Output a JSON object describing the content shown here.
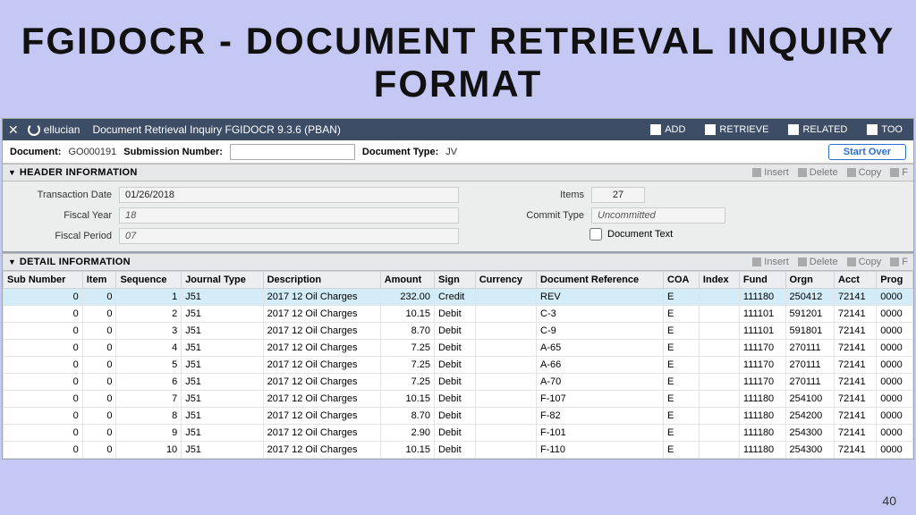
{
  "slide": {
    "title": "FGIDOCR - DOCUMENT RETRIEVAL INQUIRY FORMAT",
    "page_number": "40"
  },
  "topbar": {
    "brand": "ellucian",
    "title": "Document Retrieval Inquiry FGIDOCR 9.3.6 (PBAN)",
    "tools": {
      "add": "ADD",
      "retrieve": "RETRIEVE",
      "related": "RELATED",
      "too": "TOO"
    }
  },
  "subbar": {
    "document_label": "Document:",
    "document_value": "GO000191",
    "submission_label": "Submission Number:",
    "submission_value": "",
    "doctype_label": "Document Type:",
    "doctype_value": "JV",
    "start_over": "Start Over"
  },
  "sections": {
    "header": "HEADER INFORMATION",
    "detail": "DETAIL INFORMATION",
    "tools": {
      "insert": "Insert",
      "delete": "Delete",
      "copy": "Copy",
      "filter": "F"
    }
  },
  "header_info": {
    "transaction_date_label": "Transaction Date",
    "transaction_date": "01/26/2018",
    "fiscal_year_label": "Fiscal Year",
    "fiscal_year": "18",
    "fiscal_period_label": "Fiscal Period",
    "fiscal_period": "07",
    "items_label": "Items",
    "items": "27",
    "commit_type_label": "Commit Type",
    "commit_type": "Uncommitted",
    "document_text_label": "Document Text"
  },
  "columns": [
    "Sub Number",
    "Item",
    "Sequence",
    "Journal Type",
    "Description",
    "Amount",
    "Sign",
    "Currency",
    "Document Reference",
    "COA",
    "Index",
    "Fund",
    "Orgn",
    "Acct",
    "Prog"
  ],
  "rows": [
    {
      "sub": "0",
      "item": "0",
      "seq": "1",
      "jtype": "J51",
      "desc": "2017 12 Oil Charges",
      "amount": "232.00",
      "sign": "Credit",
      "curr": "",
      "docref": "REV",
      "coa": "E",
      "index": "",
      "fund": "111180",
      "orgn": "250412",
      "acct": "72141",
      "prog": "0000"
    },
    {
      "sub": "0",
      "item": "0",
      "seq": "2",
      "jtype": "J51",
      "desc": "2017 12 Oil Charges",
      "amount": "10.15",
      "sign": "Debit",
      "curr": "",
      "docref": "C-3",
      "coa": "E",
      "index": "",
      "fund": "111101",
      "orgn": "591201",
      "acct": "72141",
      "prog": "0000"
    },
    {
      "sub": "0",
      "item": "0",
      "seq": "3",
      "jtype": "J51",
      "desc": "2017 12 Oil Charges",
      "amount": "8.70",
      "sign": "Debit",
      "curr": "",
      "docref": "C-9",
      "coa": "E",
      "index": "",
      "fund": "111101",
      "orgn": "591801",
      "acct": "72141",
      "prog": "0000"
    },
    {
      "sub": "0",
      "item": "0",
      "seq": "4",
      "jtype": "J51",
      "desc": "2017 12 Oil Charges",
      "amount": "7.25",
      "sign": "Debit",
      "curr": "",
      "docref": "A-65",
      "coa": "E",
      "index": "",
      "fund": "111170",
      "orgn": "270111",
      "acct": "72141",
      "prog": "0000"
    },
    {
      "sub": "0",
      "item": "0",
      "seq": "5",
      "jtype": "J51",
      "desc": "2017 12 Oil Charges",
      "amount": "7.25",
      "sign": "Debit",
      "curr": "",
      "docref": "A-66",
      "coa": "E",
      "index": "",
      "fund": "111170",
      "orgn": "270111",
      "acct": "72141",
      "prog": "0000"
    },
    {
      "sub": "0",
      "item": "0",
      "seq": "6",
      "jtype": "J51",
      "desc": "2017 12 Oil Charges",
      "amount": "7.25",
      "sign": "Debit",
      "curr": "",
      "docref": "A-70",
      "coa": "E",
      "index": "",
      "fund": "111170",
      "orgn": "270111",
      "acct": "72141",
      "prog": "0000"
    },
    {
      "sub": "0",
      "item": "0",
      "seq": "7",
      "jtype": "J51",
      "desc": "2017 12 Oil Charges",
      "amount": "10.15",
      "sign": "Debit",
      "curr": "",
      "docref": "F-107",
      "coa": "E",
      "index": "",
      "fund": "111180",
      "orgn": "254100",
      "acct": "72141",
      "prog": "0000"
    },
    {
      "sub": "0",
      "item": "0",
      "seq": "8",
      "jtype": "J51",
      "desc": "2017 12 Oil Charges",
      "amount": "8.70",
      "sign": "Debit",
      "curr": "",
      "docref": "F-82",
      "coa": "E",
      "index": "",
      "fund": "111180",
      "orgn": "254200",
      "acct": "72141",
      "prog": "0000"
    },
    {
      "sub": "0",
      "item": "0",
      "seq": "9",
      "jtype": "J51",
      "desc": "2017 12 Oil Charges",
      "amount": "2.90",
      "sign": "Debit",
      "curr": "",
      "docref": "F-101",
      "coa": "E",
      "index": "",
      "fund": "111180",
      "orgn": "254300",
      "acct": "72141",
      "prog": "0000"
    },
    {
      "sub": "0",
      "item": "0",
      "seq": "10",
      "jtype": "J51",
      "desc": "2017 12 Oil Charges",
      "amount": "10.15",
      "sign": "Debit",
      "curr": "",
      "docref": "F-110",
      "coa": "E",
      "index": "",
      "fund": "111180",
      "orgn": "254300",
      "acct": "72141",
      "prog": "0000"
    }
  ]
}
